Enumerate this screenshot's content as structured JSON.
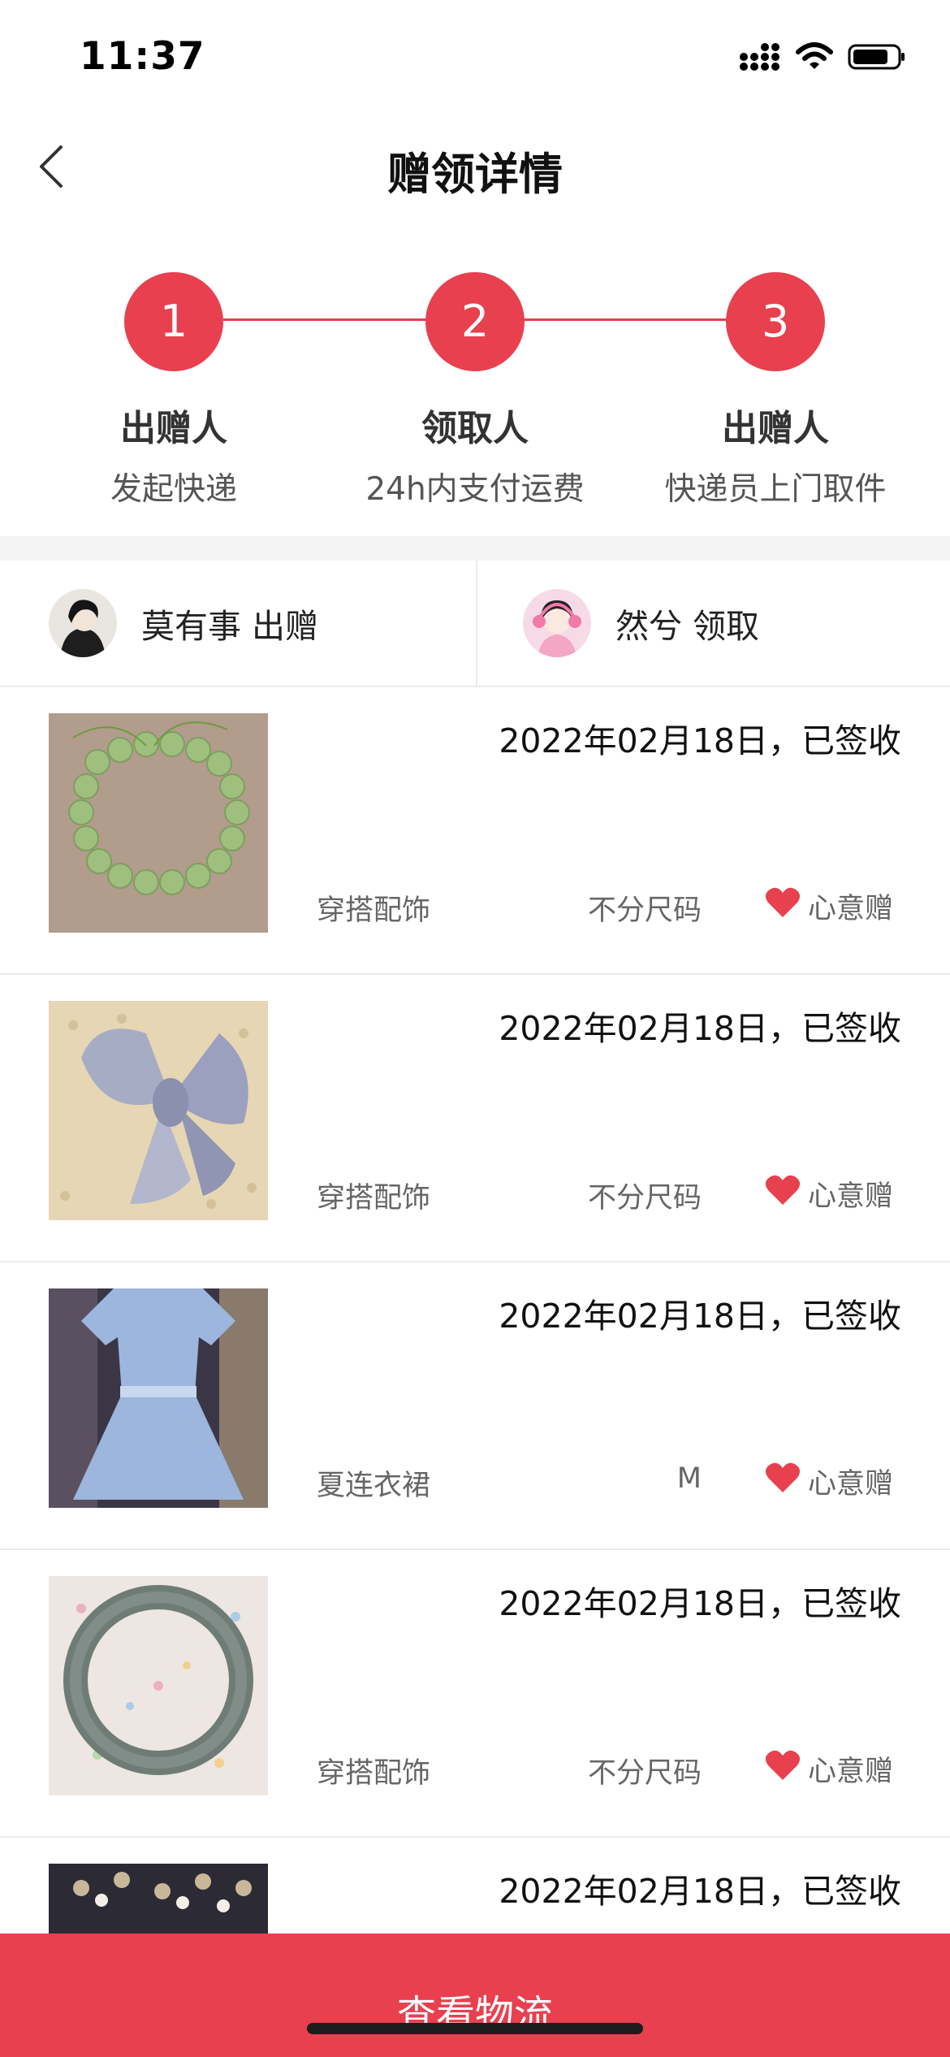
{
  "status_bar": {
    "time": "11:37",
    "icons": [
      "cellular-signal-icon",
      "wifi-icon",
      "battery-icon"
    ]
  },
  "nav": {
    "title": "赠领详情",
    "back_icon": "chevron-left-icon"
  },
  "steps": [
    {
      "number": "1",
      "title": "出赠人",
      "subtitle": "发起快递"
    },
    {
      "number": "2",
      "title": "领取人",
      "subtitle": "24h内支付运费"
    },
    {
      "number": "3",
      "title": "出赠人",
      "subtitle": "快递员上门取件"
    }
  ],
  "parties": {
    "giver": {
      "label": "莫有事 出赠"
    },
    "receiver": {
      "label": "然兮 领取"
    }
  },
  "items": [
    {
      "date": "2022年02月18日，已签收",
      "category": "穿搭配饰",
      "size": "不分尺码",
      "tag": "心意赠",
      "image": "green-bead-bracelet"
    },
    {
      "date": "2022年02月18日，已签收",
      "category": "穿搭配饰",
      "size": "不分尺码",
      "tag": "心意赠",
      "image": "satin-bow"
    },
    {
      "date": "2022年02月18日，已签收",
      "category": "夏连衣裙",
      "size": "M",
      "tag": "心意赠",
      "image": "blue-dress"
    },
    {
      "date": "2022年02月18日，已签收",
      "category": "穿搭配饰",
      "size": "不分尺码",
      "tag": "心意赠",
      "image": "jade-bangle"
    },
    {
      "date": "2022年02月18日，已签收",
      "category": "",
      "size": "",
      "tag": "",
      "image": "pearl-hair-clip"
    }
  ],
  "bottom_button": {
    "label": "查看物流"
  },
  "colors": {
    "accent": "#e8404f",
    "divider": "#ececec",
    "band": "#f3f3f3"
  }
}
